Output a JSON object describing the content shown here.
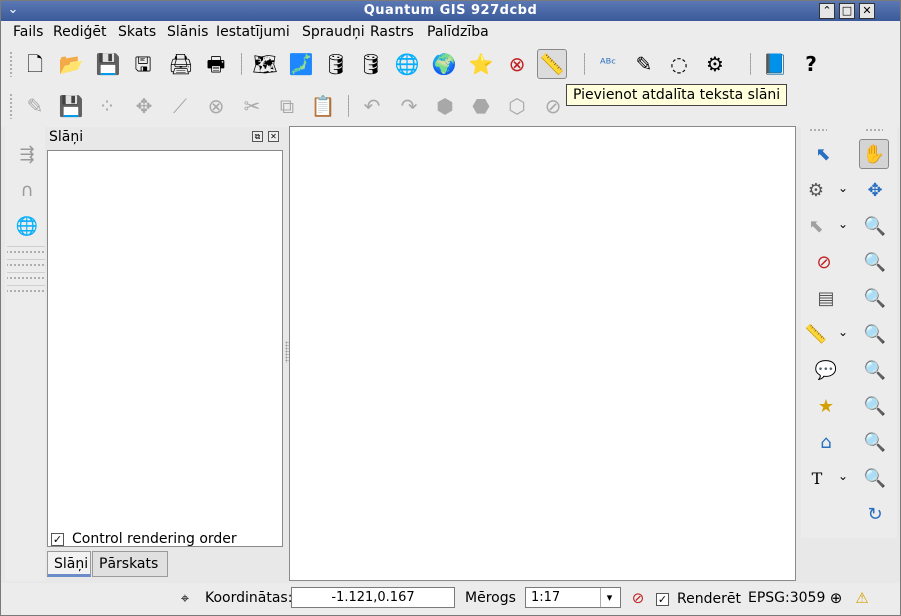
{
  "window": {
    "title": "Quantum GIS 927dcbd",
    "menu_glyph": "⌄",
    "btn_min": "⌃",
    "btn_restore": "□",
    "btn_close": "✕"
  },
  "menu": {
    "items": [
      {
        "label": "Fails"
      },
      {
        "label": "Rediģēt"
      },
      {
        "label": "Skats"
      },
      {
        "label": "Slānis"
      },
      {
        "label": "Iestatījumi"
      },
      {
        "label": "Spraudņi"
      },
      {
        "label": "Rastrs"
      },
      {
        "label": "Palīdzība"
      }
    ]
  },
  "toolbar1": {
    "icons": [
      {
        "name": "new-project-icon",
        "glyph": "🗋"
      },
      {
        "name": "open-project-icon",
        "glyph": "📂"
      },
      {
        "name": "save-project-icon",
        "glyph": "💾"
      },
      {
        "name": "save-as-icon",
        "glyph": "🖫"
      },
      {
        "name": "print-composer-icon",
        "glyph": "🖨"
      },
      {
        "name": "print-icon",
        "glyph": "🖶"
      },
      {
        "name": "add-vector-layer-icon",
        "glyph": "🗺"
      },
      {
        "name": "add-raster-layer-icon",
        "glyph": "🗾"
      },
      {
        "name": "add-postgis-layer-icon",
        "glyph": "🛢"
      },
      {
        "name": "add-spatialite-layer-icon",
        "glyph": "🛢"
      },
      {
        "name": "add-wms-layer-icon",
        "glyph": "🌐"
      },
      {
        "name": "add-wfs-layer-icon",
        "glyph": "🌍"
      },
      {
        "name": "new-shapefile-icon",
        "glyph": "⭐"
      },
      {
        "name": "remove-layer-icon",
        "glyph": "⊗"
      },
      {
        "name": "add-delimited-text-icon",
        "glyph": "📏"
      },
      {
        "name": "label-icon",
        "glyph": "ᴬᴮᶜ"
      },
      {
        "name": "plugin-1-icon",
        "glyph": "✎"
      },
      {
        "name": "plugin-2-icon",
        "glyph": "◌"
      },
      {
        "name": "plugin-3-icon",
        "glyph": "⚙"
      },
      {
        "name": "help-contents-icon",
        "glyph": "📘"
      },
      {
        "name": "whats-this-icon",
        "glyph": "?"
      }
    ]
  },
  "toolbar2": {
    "icons": [
      {
        "name": "toggle-editing-icon",
        "glyph": "✎"
      },
      {
        "name": "save-edits-icon",
        "glyph": "💾"
      },
      {
        "name": "capture-point-icon",
        "glyph": "⁘"
      },
      {
        "name": "move-feature-icon",
        "glyph": "✥"
      },
      {
        "name": "node-tool-icon",
        "glyph": "⟋"
      },
      {
        "name": "delete-selected-icon",
        "glyph": "⊗"
      },
      {
        "name": "cut-features-icon",
        "glyph": "✂"
      },
      {
        "name": "copy-features-icon",
        "glyph": "⧉"
      },
      {
        "name": "paste-features-icon",
        "glyph": "📋"
      },
      {
        "name": "undo-icon",
        "glyph": "↶"
      },
      {
        "name": "redo-icon",
        "glyph": "↷"
      },
      {
        "name": "simplify-feature-icon",
        "glyph": "⬢"
      },
      {
        "name": "add-ring-icon",
        "glyph": "⬣"
      },
      {
        "name": "add-island-icon",
        "glyph": "⬡"
      },
      {
        "name": "delete-ring-icon",
        "glyph": "⊘"
      }
    ]
  },
  "tooltip": {
    "text": "Pievienot atdalīta teksta slāni"
  },
  "layers_dock": {
    "title": "Slāņi",
    "float_glyph": "⧉",
    "close_glyph": "✕",
    "control_rendering_label": "Control rendering order",
    "control_rendering_checked": "✓",
    "tabs": [
      {
        "label": "Slāņi"
      },
      {
        "label": "Pārskats"
      }
    ]
  },
  "left_strip": {
    "icons": [
      {
        "name": "digitize-icon",
        "glyph": "⇶"
      },
      {
        "name": "histogram-icon",
        "glyph": "∩"
      },
      {
        "name": "globe-icon",
        "glyph": "🌐"
      }
    ]
  },
  "right_toolbar_a": {
    "icons": [
      {
        "name": "identify-features-icon",
        "glyph": "⬉"
      },
      {
        "name": "action-gear-icon",
        "glyph": "⚙"
      },
      {
        "name": "select-features-icon",
        "glyph": "⬉"
      },
      {
        "name": "deselect-icon",
        "glyph": "⊘"
      },
      {
        "name": "attribute-table-icon",
        "glyph": "▤"
      },
      {
        "name": "measure-line-icon",
        "glyph": "📏"
      },
      {
        "name": "map-tips-icon",
        "glyph": "💬"
      },
      {
        "name": "new-bookmark-icon",
        "glyph": "★"
      },
      {
        "name": "show-bookmarks-icon",
        "glyph": "⌂"
      },
      {
        "name": "text-annotation-icon",
        "glyph": "T"
      }
    ],
    "chevron": "⌄"
  },
  "right_toolbar_b": {
    "icons": [
      {
        "name": "pan-map-icon",
        "glyph": "✋"
      },
      {
        "name": "pan-to-selected-icon",
        "glyph": "✥"
      },
      {
        "name": "zoom-in-icon",
        "glyph": "🔍"
      },
      {
        "name": "zoom-out-icon",
        "glyph": "🔍"
      },
      {
        "name": "zoom-actual-icon",
        "glyph": "🔍"
      },
      {
        "name": "zoom-full-icon",
        "glyph": "🔍"
      },
      {
        "name": "zoom-to-selection-icon",
        "glyph": "🔍"
      },
      {
        "name": "zoom-to-layer-icon",
        "glyph": "🔍"
      },
      {
        "name": "zoom-last-icon",
        "glyph": "🔍"
      },
      {
        "name": "zoom-next-icon",
        "glyph": "🔍"
      },
      {
        "name": "refresh-icon",
        "glyph": "↻"
      }
    ]
  },
  "statusbar": {
    "coords_icon": "⌖",
    "coords_label": "Koordinātas:",
    "coords_value": "-1.121,0.167",
    "scale_label": "Mērogs",
    "scale_value": "1:17",
    "scale_arrow": "▾",
    "stop_icon": "⊘",
    "render_checked": "✓",
    "render_label": "Renderēt",
    "crs_label": "EPSG:3059",
    "crs_icon": "⊕",
    "warning_icon": "⚠"
  },
  "colors": {
    "titlebar": "#3b5a99",
    "tooltip_bg": "#ffffdc",
    "canvas_bg": "#ffffff"
  }
}
